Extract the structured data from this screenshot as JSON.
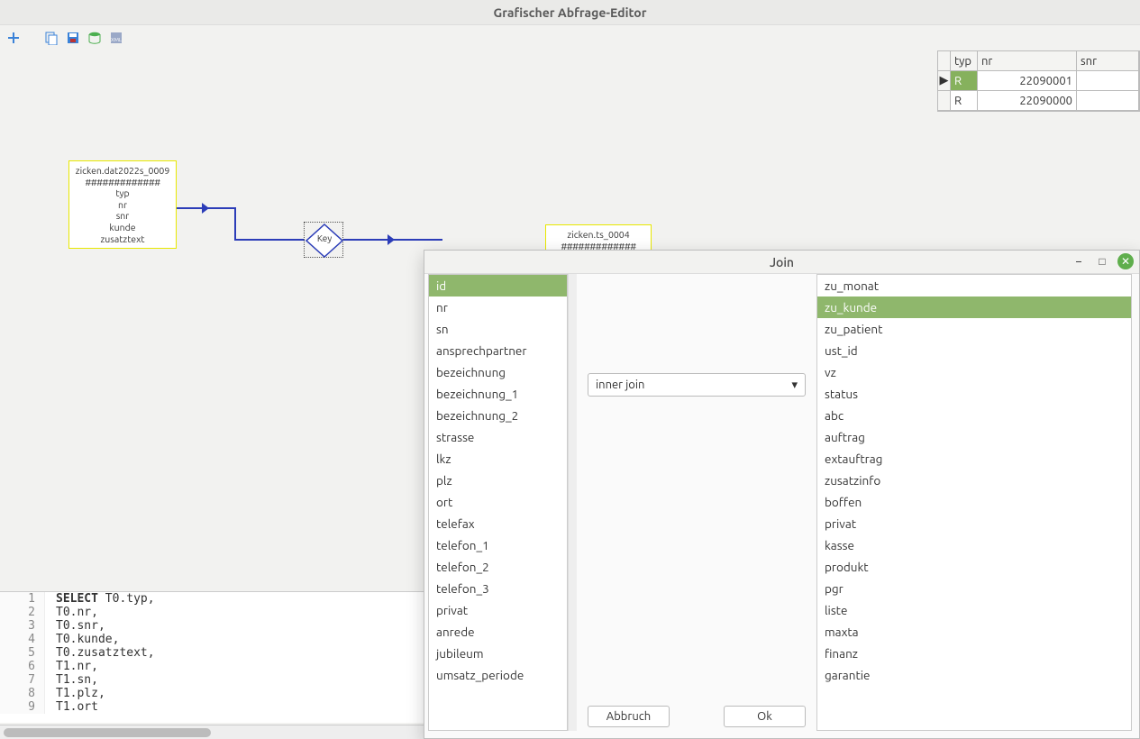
{
  "window": {
    "title": "Grafischer Abfrage-Editor"
  },
  "toolbar": {
    "icons": [
      "add-icon",
      "copy-icon",
      "save-icon",
      "db-sql-icon",
      "export-xml-icon"
    ]
  },
  "canvas": {
    "entity1": {
      "name": "zicken.dat2022s_0009",
      "hashes": "#############",
      "fields": [
        "typ",
        "nr",
        "snr",
        "kunde",
        "zusatztext"
      ]
    },
    "entity2": {
      "name": "zicken.ts_0004",
      "hashes": "#############"
    },
    "key_label": "Key"
  },
  "results": {
    "columns": [
      "typ",
      "nr",
      "snr"
    ],
    "rows": [
      {
        "typ": "R",
        "nr": "22090001",
        "snr": "",
        "current": true
      },
      {
        "typ": "R",
        "nr": "22090000",
        "snr": "",
        "current": false
      }
    ]
  },
  "sql": {
    "lines": [
      {
        "n": "1",
        "kw": "SELECT ",
        "rest": "T0.typ,"
      },
      {
        "n": "2",
        "kw": "",
        "rest": "T0.nr,"
      },
      {
        "n": "3",
        "kw": "",
        "rest": "T0.snr,"
      },
      {
        "n": "4",
        "kw": "",
        "rest": "T0.kunde,"
      },
      {
        "n": "5",
        "kw": "",
        "rest": "T0.zusatztext,"
      },
      {
        "n": "6",
        "kw": "",
        "rest": "T1.nr,"
      },
      {
        "n": "7",
        "kw": "",
        "rest": "T1.sn,"
      },
      {
        "n": "8",
        "kw": "",
        "rest": "T1.plz,"
      },
      {
        "n": "9",
        "kw": "",
        "rest": "T1.ort"
      }
    ]
  },
  "join_dialog": {
    "title": "Join",
    "join_type": "inner join",
    "left": {
      "selected": "id",
      "fields": [
        "id",
        "nr",
        "sn",
        "ansprechpartner",
        "bezeichnung",
        "bezeichnung_1",
        "bezeichnung_2",
        "strasse",
        "lkz",
        "plz",
        "ort",
        "telefax",
        "telefon_1",
        "telefon_2",
        "telefon_3",
        "privat",
        "anrede",
        "jubileum",
        "umsatz_periode"
      ]
    },
    "right": {
      "selected": "zu_kunde",
      "fields": [
        "zu_monat",
        "zu_kunde",
        "zu_patient",
        "ust_id",
        "vz",
        "status",
        "abc",
        "auftrag",
        "extauftrag",
        "zusatzinfo",
        "boffen",
        "privat",
        "kasse",
        "produkt",
        "pgr",
        "liste",
        "maxta",
        "finanz",
        "garantie"
      ]
    },
    "buttons": {
      "cancel": "Abbruch",
      "ok": "Ok"
    }
  }
}
